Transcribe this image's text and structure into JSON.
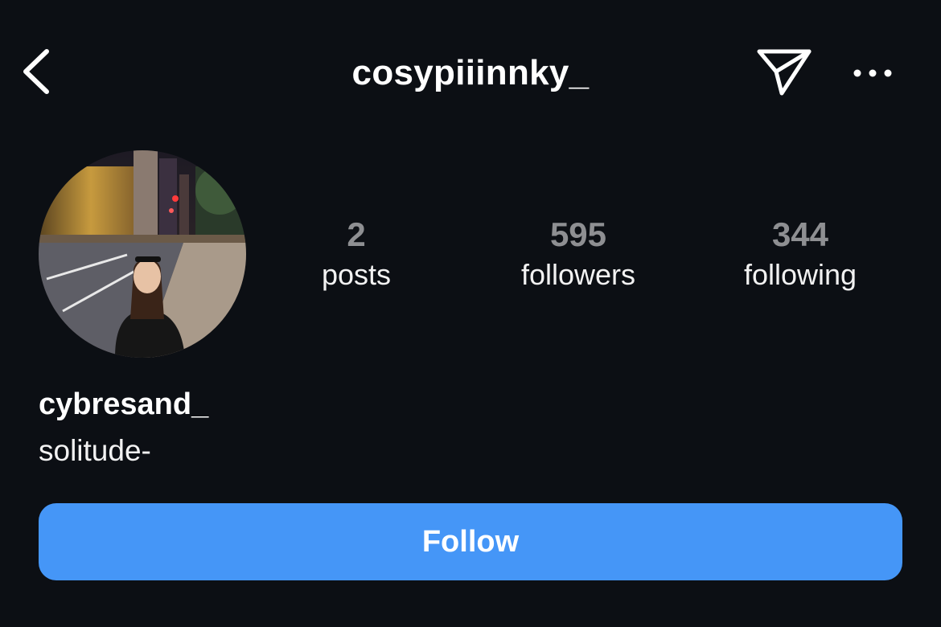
{
  "header": {
    "username": "cosypiiinnky_",
    "back_icon": "chevron-left-icon",
    "share_icon": "paper-plane-icon",
    "more_icon": "ellipsis-icon"
  },
  "profile": {
    "avatar": "profile-photo",
    "display_name": "cybresand_",
    "bio": "solitude-"
  },
  "stats": {
    "posts": {
      "count": "2",
      "label": "posts"
    },
    "followers": {
      "count": "595",
      "label": "followers"
    },
    "following": {
      "count": "344",
      "label": "following"
    }
  },
  "actions": {
    "follow_label": "Follow"
  },
  "colors": {
    "background": "#0c0f14",
    "follow_button": "#4596f7",
    "stat_number": "#8e8f92"
  }
}
